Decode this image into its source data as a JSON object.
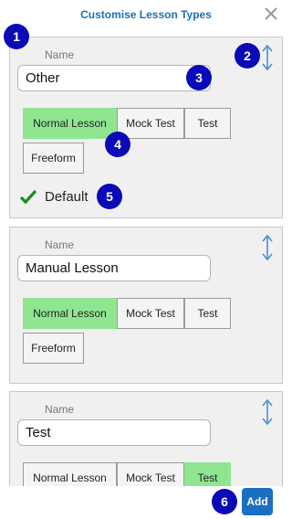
{
  "header": {
    "title": "Customise Lesson Types"
  },
  "colors": {
    "accent": "#1a6fb3",
    "selected": "#90e690",
    "badge": "#0a0ab8",
    "check": "#1e8a1e"
  },
  "labels": {
    "name": "Name",
    "default": "Default",
    "add": "Add"
  },
  "lesson_types": [
    {
      "name": "Other",
      "types": [
        {
          "label": "Normal Lesson",
          "selected": true
        },
        {
          "label": "Mock Test",
          "selected": false
        },
        {
          "label": "Test",
          "selected": false
        },
        {
          "label": "Freeform",
          "selected": false
        }
      ],
      "is_default": true
    },
    {
      "name": "Manual Lesson",
      "types": [
        {
          "label": "Normal Lesson",
          "selected": true
        },
        {
          "label": "Mock Test",
          "selected": false
        },
        {
          "label": "Test",
          "selected": false
        },
        {
          "label": "Freeform",
          "selected": false
        }
      ],
      "is_default": false
    },
    {
      "name": "Test",
      "types": [
        {
          "label": "Normal Lesson",
          "selected": false
        },
        {
          "label": "Mock Test",
          "selected": false
        },
        {
          "label": "Test",
          "selected": true
        }
      ],
      "is_default": false
    }
  ],
  "markers": [
    "1",
    "2",
    "3",
    "4",
    "5",
    "6"
  ]
}
